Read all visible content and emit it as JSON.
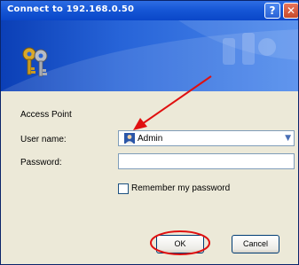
{
  "window": {
    "title": "Connect to 192.168.0.50",
    "help_glyph": "?",
    "close_glyph": "✕"
  },
  "form": {
    "realm_label": "Access Point",
    "user_label": "User name:",
    "user_value": "Admin",
    "password_label": "Password:",
    "password_value": "",
    "remember_label": "Remember my password",
    "remember_checked": false
  },
  "buttons": {
    "ok_label": "OK",
    "cancel_label": "Cancel"
  },
  "icons": {
    "banner": "keys-icon",
    "user_avatar": "user-avatar-icon",
    "dropdown": "chevron-down-icon"
  },
  "colors": {
    "titlebar": "#0a46c8",
    "dialog_bg": "#ece9d8",
    "annotation": "#e01010"
  }
}
